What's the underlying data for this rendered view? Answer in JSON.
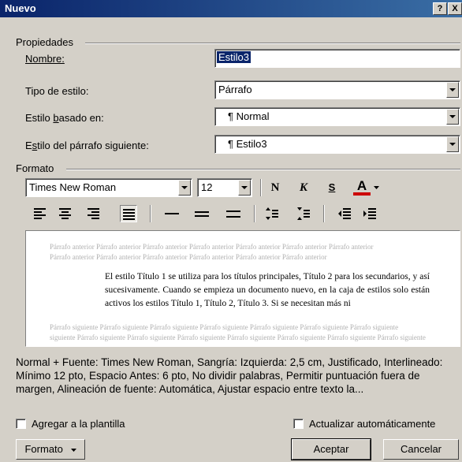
{
  "window": {
    "title": "Nuevo",
    "help_btn": "?",
    "close_btn": "X"
  },
  "properties": {
    "group_label": "Propiedades",
    "name_label": "Nombre:",
    "name_value": "Estilo3",
    "type_label": "Tipo de estilo:",
    "type_value": "Párrafo",
    "based_label": "Estilo basado en:",
    "based_value": "¶ Normal",
    "next_label": "Estilo del párrafo siguiente:",
    "next_value": "¶ Estilo3"
  },
  "format": {
    "group_label": "Formato",
    "font_value": "Times New Roman",
    "size_value": "12",
    "bold_label": "N",
    "italic_label": "K",
    "underline_label": "S",
    "font_color_label": "A",
    "font_color": "#cc0000"
  },
  "preview": {
    "prev_para_1": "Párrafo anterior Párrafo anterior Párrafo anterior Párrafo anterior Párrafo anterior Párrafo anterior Párrafo anterior",
    "prev_para_2": "Párrafo anterior Párrafo anterior Párrafo anterior Párrafo anterior Párrafo anterior Párrafo anterior",
    "sample_text": "El estilo Título 1 se utiliza para los títulos principales, Título 2 para los secundarios, y así sucesivamente. Cuando se empieza un documento nuevo, en la caja de estilos solo están activos los estilos Título 1, Título 2, Título 3. Si se necesitan más ni",
    "next_para_1": "Párrafo siguiente Párrafo siguiente Párrafo siguiente Párrafo siguiente Párrafo siguiente Párrafo siguiente Párrafo siguiente",
    "next_para_2": "siguiente Párrafo siguiente Párrafo siguiente Párrafo siguiente Párrafo siguiente Párrafo siguiente Párrafo siguiente Párrafo siguiente"
  },
  "description": "Normal + Fuente: Times New Roman, Sangría: Izquierda:  2,5 cm, Justificado, Interlineado:  Mínimo 12 pto, Espacio Antes:  6 pto, No dividir palabras, Permitir puntuación fuera de margen, Alineación de fuente: Automática, Ajustar espacio entre texto la...",
  "options": {
    "add_template_label": "Agregar a la plantilla",
    "auto_update_label": "Actualizar automáticamente"
  },
  "buttons": {
    "format_label": "Formato",
    "accept_label": "Aceptar",
    "cancel_label": "Cancelar"
  }
}
